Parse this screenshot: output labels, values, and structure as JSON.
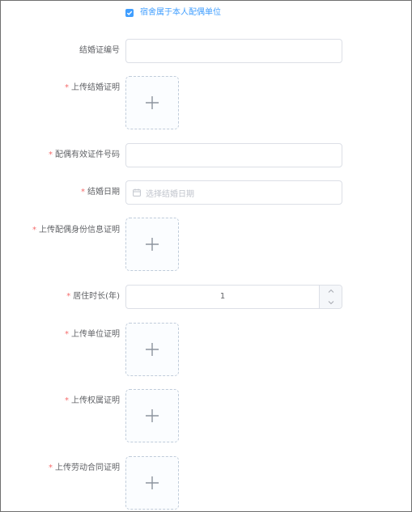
{
  "dorm_checkbox": {
    "label": "宿舍属于本人配偶单位",
    "checked": true
  },
  "fields": {
    "marriage_cert_no": {
      "label": "结婚证编号",
      "required": false,
      "value": ""
    },
    "marriage_proof_upload": {
      "label": "上传结婚证明",
      "required": true
    },
    "spouse_id_no": {
      "label": "配偶有效证件号码",
      "required": true,
      "value": ""
    },
    "marriage_date": {
      "label": "结婚日期",
      "required": true,
      "placeholder": "选择结婚日期"
    },
    "spouse_id_upload": {
      "label": "上传配偶身份信息证明",
      "required": true
    },
    "residence_years": {
      "label": "居住时长(年)",
      "required": true,
      "value": "1"
    },
    "employer_proof_upload": {
      "label": "上传单位证明",
      "required": true
    },
    "ownership_proof_upload": {
      "label": "上传权属证明",
      "required": true
    },
    "labor_contract_upload": {
      "label": "上传劳动合同证明",
      "required": true
    }
  },
  "required_marker": "*",
  "colors": {
    "accent": "#409eff",
    "required": "#f56c6c",
    "border": "#dcdfe6",
    "upload_border": "#c0ccda"
  },
  "icons": {
    "checkbox": "check-icon",
    "upload": "plus-icon",
    "date": "calendar-icon",
    "stepper_up": "chevron-up-icon",
    "stepper_down": "chevron-down-icon"
  }
}
